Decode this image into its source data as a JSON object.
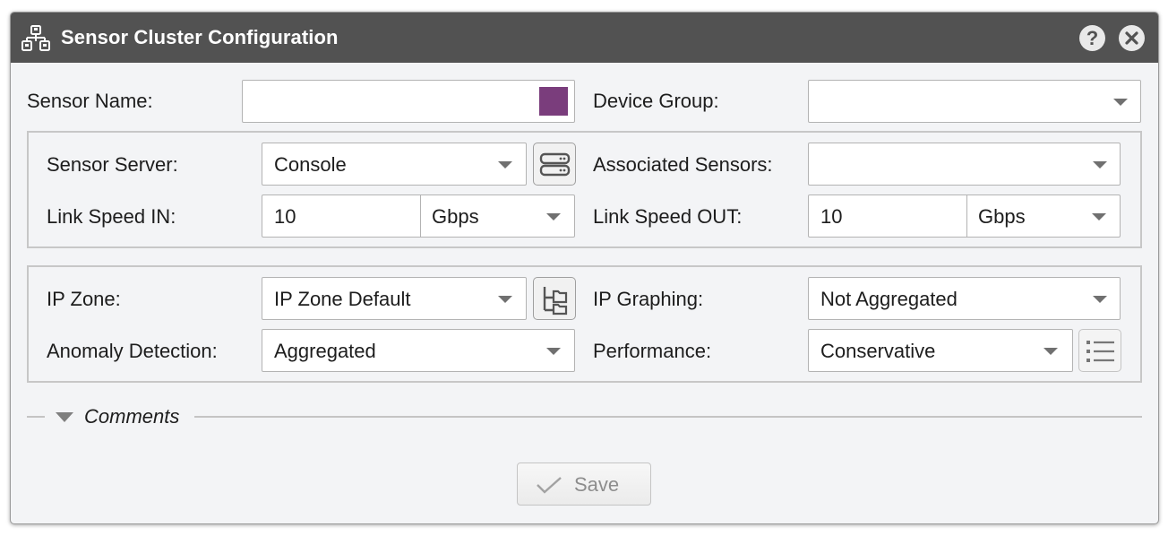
{
  "window": {
    "title": "Sensor Cluster Configuration",
    "title_icon": "cluster-icon",
    "help_label": "?",
    "help_icon": "help-icon",
    "close_icon": "close-icon"
  },
  "form": {
    "sensor_name": {
      "label": "Sensor Name:",
      "value": "",
      "color_swatch": "#7a3d7c"
    },
    "device_group": {
      "label": "Device Group:",
      "value": ""
    },
    "sensor_server": {
      "label": "Sensor Server:",
      "value": "Console",
      "button_icon": "server-icon"
    },
    "associated_sensors": {
      "label": "Associated Sensors:",
      "value": ""
    },
    "link_speed_in": {
      "label": "Link Speed IN:",
      "value": "10",
      "unit": "Gbps"
    },
    "link_speed_out": {
      "label": "Link Speed OUT:",
      "value": "10",
      "unit": "Gbps"
    },
    "ip_zone": {
      "label": "IP Zone:",
      "value": "IP Zone Default",
      "button_icon": "tree-icon"
    },
    "ip_graphing": {
      "label": "IP Graphing:",
      "value": "Not Aggregated"
    },
    "anomaly_detection": {
      "label": "Anomaly Detection:",
      "value": "Aggregated"
    },
    "performance": {
      "label": "Performance:",
      "value": "Conservative",
      "button_icon": "list-icon"
    }
  },
  "comments": {
    "label": "Comments",
    "state": "collapsed"
  },
  "footer": {
    "save_label": "Save",
    "save_icon": "checkmark-icon"
  },
  "colors": {
    "titlebar": "#525252",
    "background": "#f3f4f6",
    "swatch": "#7a3d7c"
  }
}
